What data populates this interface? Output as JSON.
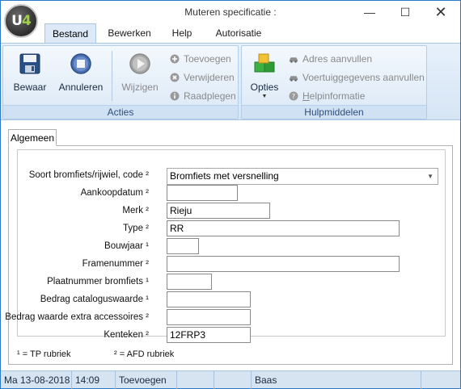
{
  "window": {
    "title": "Muteren specificatie :",
    "logo_text_main": "U",
    "logo_text_accent": "4",
    "minimize": "—",
    "maximize": "☐",
    "close": "✕"
  },
  "ribbon_tabs": [
    {
      "label": "Bestand",
      "active": true
    },
    {
      "label": "Bewerken",
      "active": false
    },
    {
      "label": "Help",
      "active": false
    },
    {
      "label": "Autorisatie",
      "active": false
    }
  ],
  "ribbon": {
    "acties": {
      "group_label": "Acties",
      "bewaar": "Bewaar",
      "annuleren": "Annuleren",
      "wijzigen": "Wijzigen",
      "toevoegen": "Toevoegen",
      "verwijderen": "Verwijderen",
      "raadplegen": "Raadplegen"
    },
    "hulpmiddelen": {
      "group_label": "Hulpmiddelen",
      "opties": "Opties",
      "adres_aanvullen": "Adres aanvullen",
      "voertuiggegevens": "Voertuiggegevens aanvullen",
      "helpinformatie_u": "H",
      "helpinformatie_rest": "elpinformatie"
    }
  },
  "page_tab": "Algemeen",
  "form": {
    "soort": {
      "label": "Soort bromfiets/rijwiel, code ²",
      "value": "Bromfiets met versnelling"
    },
    "aankoopdatum": {
      "label": "Aankoopdatum ²",
      "value": ""
    },
    "merk": {
      "label": "Merk ²",
      "value": "Rieju"
    },
    "type": {
      "label": "Type ²",
      "value": "RR"
    },
    "bouwjaar": {
      "label": "Bouwjaar ¹",
      "value": ""
    },
    "framenummer": {
      "label": "Framenummer ²",
      "value": ""
    },
    "plaatnummer": {
      "label": "Plaatnummer bromfiets ¹",
      "value": ""
    },
    "catalogus": {
      "label": "Bedrag cataloguswaarde ¹",
      "value": ""
    },
    "accessoires": {
      "label": "Bedrag waarde extra accessoires ²",
      "value": ""
    },
    "kenteken": {
      "label": "Kenteken ²",
      "value": "12FRP3"
    }
  },
  "legend": {
    "tp": "¹ = TP rubriek",
    "afd": "² = AFD rubriek"
  },
  "statusbar": {
    "date": "Ma  13-08-2018",
    "time": "14:09",
    "mode": "Toevoegen",
    "empty1": "",
    "empty2": "",
    "user": "Baas",
    "empty3": ""
  }
}
